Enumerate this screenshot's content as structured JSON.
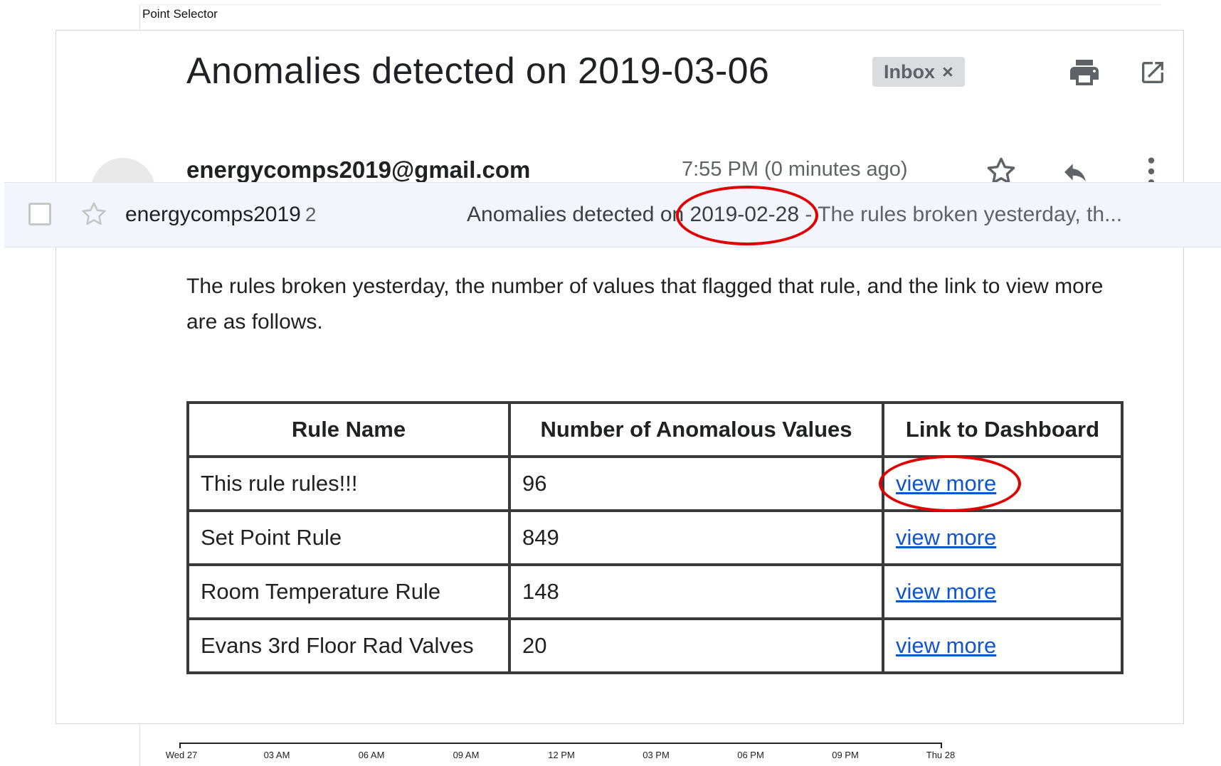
{
  "background_app": {
    "title": "Point Selector",
    "timeline_ticks": [
      "Wed 27",
      "03 AM",
      "06 AM",
      "09 AM",
      "12 PM",
      "03 PM",
      "06 PM",
      "09 PM",
      "Thu 28"
    ]
  },
  "email": {
    "subject": "Anomalies detected on 2019-03-06",
    "label_badge": "Inbox",
    "label_remove_glyph": "×",
    "sender": "energycomps2019@gmail.com",
    "time": "7:55 PM (0 minutes ago)",
    "icons": {
      "print": "print-icon",
      "open_new_window": "open-in-new-icon",
      "star": "star-icon",
      "reply": "reply-icon",
      "more": "more-vert-icon"
    },
    "body_text": "The rules broken yesterday, the number of values that flagged that rule, and the link to view more are as follows."
  },
  "list_row": {
    "sender": "energycomps2019",
    "thread_count": "2",
    "subject_prefix": "Anomalies detected on ",
    "subject_date": "2019-02-28",
    "snippet": " - The rules broken yesterday, th..."
  },
  "table": {
    "headers": [
      "Rule Name",
      "Number of Anomalous Values",
      "Link to Dashboard"
    ],
    "rows": [
      {
        "rule": "This rule rules!!!",
        "count": "96",
        "link": "view more"
      },
      {
        "rule": "Set Point Rule",
        "count": "849",
        "link": "view more"
      },
      {
        "rule": "Room Temperature Rule",
        "count": "148",
        "link": "view more"
      },
      {
        "rule": "Evans 3rd Floor Rad Valves",
        "count": "20",
        "link": "view more"
      }
    ]
  },
  "annotation_color": "#e00000",
  "link_color": "#1155cc"
}
